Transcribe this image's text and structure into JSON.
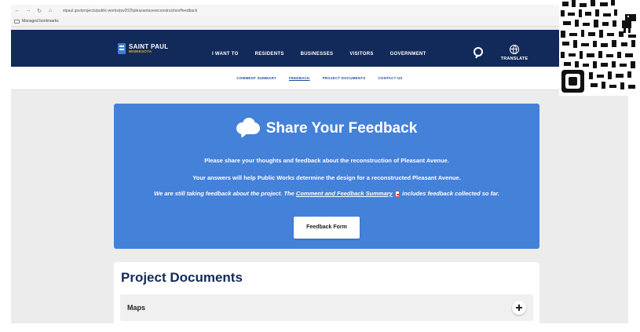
{
  "browser": {
    "url": "stpaul.gov/projects/public-works/pw2025pleasantavereconstruction#feedback",
    "bookmarks_label": "Managed bookmarks"
  },
  "header": {
    "logo_name": "SAINT PAUL",
    "logo_sub": "MINNESOTA",
    "nav": [
      "I WANT TO",
      "RESIDENTS",
      "BUSINESSES",
      "VISITORS",
      "GOVERNMENT"
    ],
    "translate_label": "TRANSLATE"
  },
  "subnav": {
    "items": [
      "COMMENT SUMMARY",
      "FEEDBACK",
      "PROJECT DOCUMENTS",
      "CONTACT US"
    ],
    "active": "FEEDBACK"
  },
  "feedback": {
    "title": "Share Your Feedback",
    "line1": "Please share your thoughts and feedback about the reconstruction of Pleasant Avenue.",
    "line2": "Your answers will help Public Works determine the design for a reconstructed Pleasant Avenue.",
    "line3_prefix": "We are still taking feedback about the project. The ",
    "line3_link": "Comment and Feedback Summary",
    "line3_suffix": " includes feedback collected so far.",
    "button_label": "Feedback Form"
  },
  "documents": {
    "title": "Project Documents",
    "items": [
      {
        "label": "Maps"
      }
    ]
  },
  "colors": {
    "header_bg": "#122a59",
    "card_blue": "#4481d8",
    "logo_gold": "#f0b323",
    "link_blue": "#1d4f9c"
  }
}
